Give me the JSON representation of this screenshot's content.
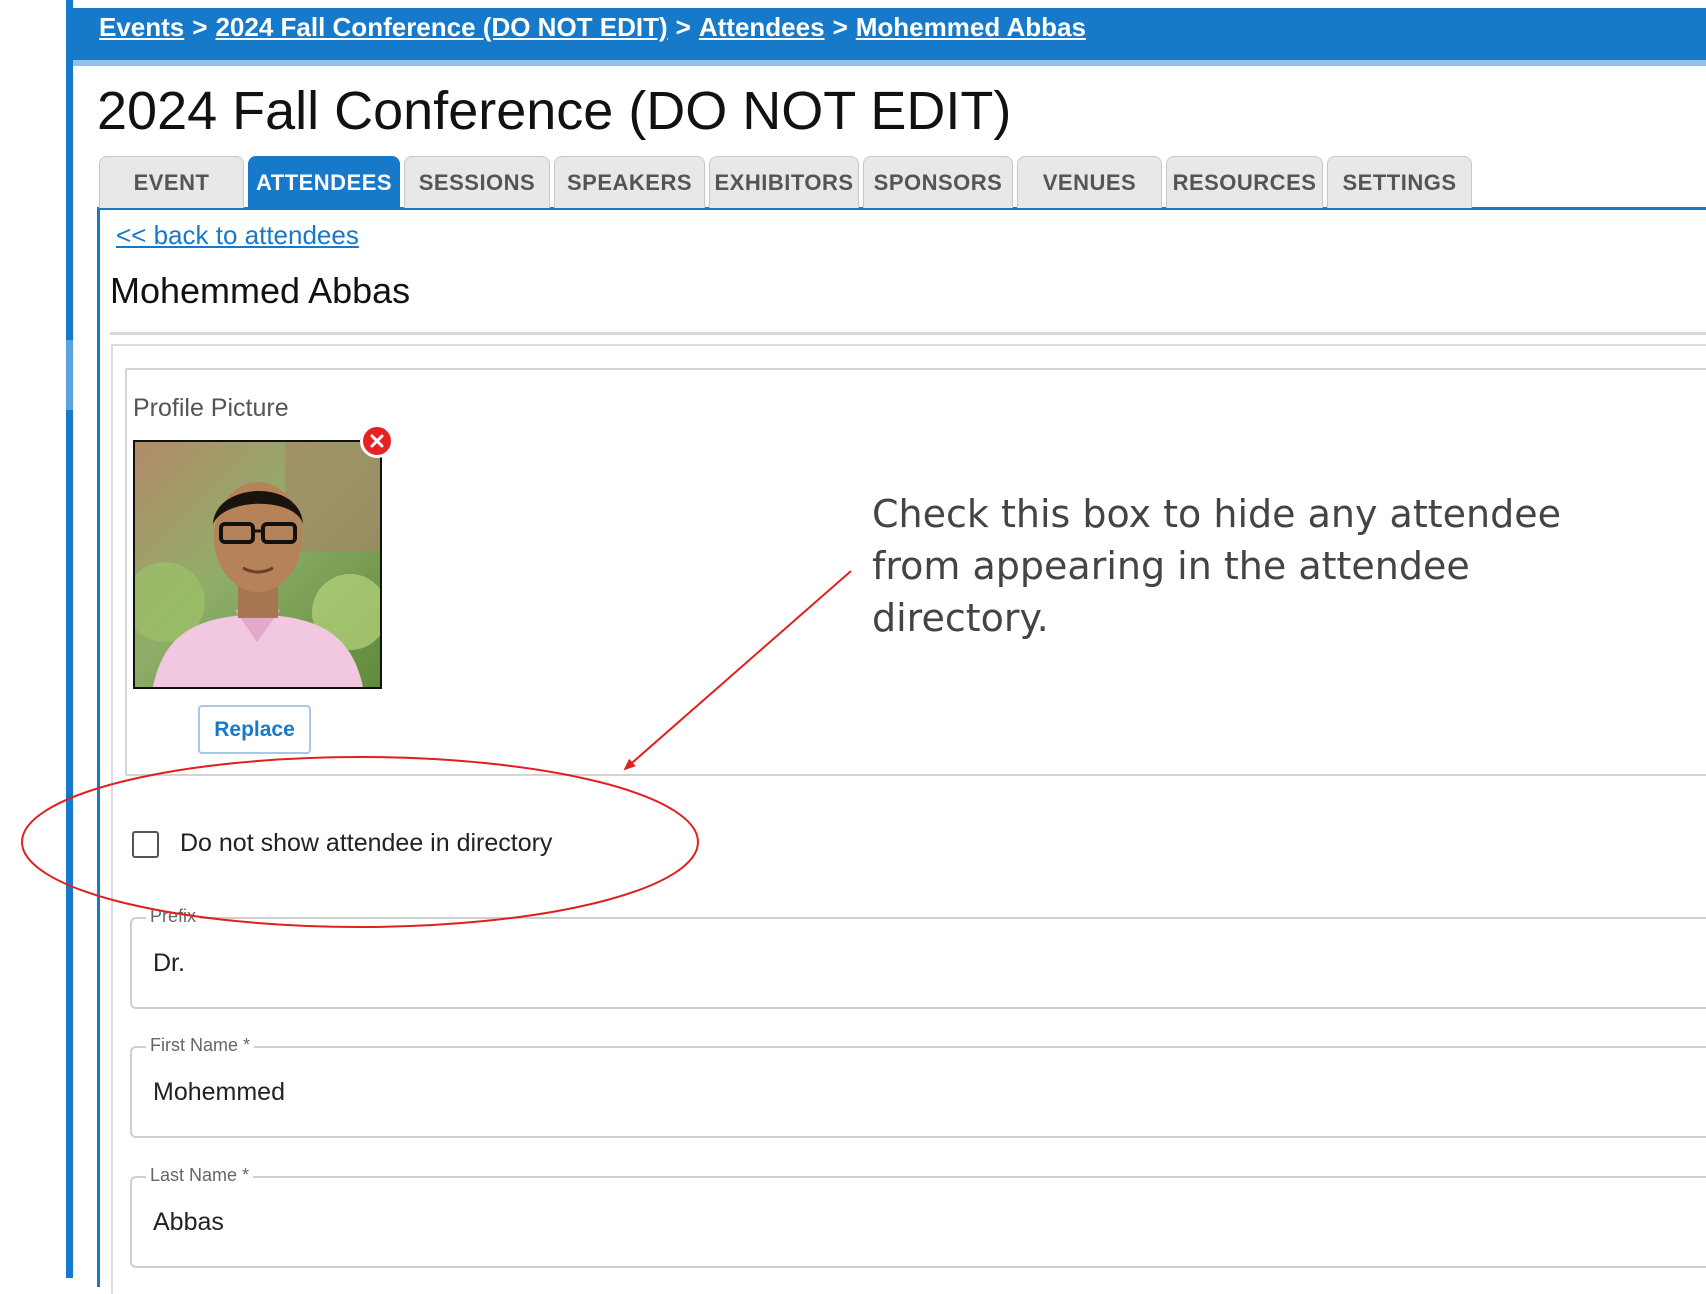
{
  "breadcrumb": {
    "events": "Events",
    "sep": ">",
    "event": "2024 Fall Conference (DO NOT EDIT)",
    "attendees": "Attendees",
    "person": "Mohemmed Abbas"
  },
  "page_title": "2024 Fall Conference (DO NOT EDIT)",
  "tabs": [
    {
      "label": "EVENT"
    },
    {
      "label": "ATTENDEES",
      "active": true
    },
    {
      "label": "SESSIONS"
    },
    {
      "label": "SPEAKERS"
    },
    {
      "label": "EXHIBITORS"
    },
    {
      "label": "SPONSORS"
    },
    {
      "label": "VENUES"
    },
    {
      "label": "RESOURCES"
    },
    {
      "label": "SETTINGS"
    }
  ],
  "back_link": "<< back to attendees",
  "attendee_name": "Mohemmed Abbas",
  "profile": {
    "label": "Profile Picture",
    "replace_label": "Replace"
  },
  "annotation": "Check this box to hide any attendee from appearing in the attendee directory.",
  "directory_checkbox": {
    "label": "Do not show attendee in directory",
    "checked": false
  },
  "fields": {
    "prefix": {
      "label": "Prefix",
      "value": "Dr."
    },
    "first_name": {
      "label": "First Name *",
      "value": "Mohemmed"
    },
    "last_name": {
      "label": "Last Name *",
      "value": "Abbas"
    }
  },
  "colors": {
    "accent": "#1779c9",
    "annotation_red": "#e02020",
    "remove_red": "#e52222"
  }
}
